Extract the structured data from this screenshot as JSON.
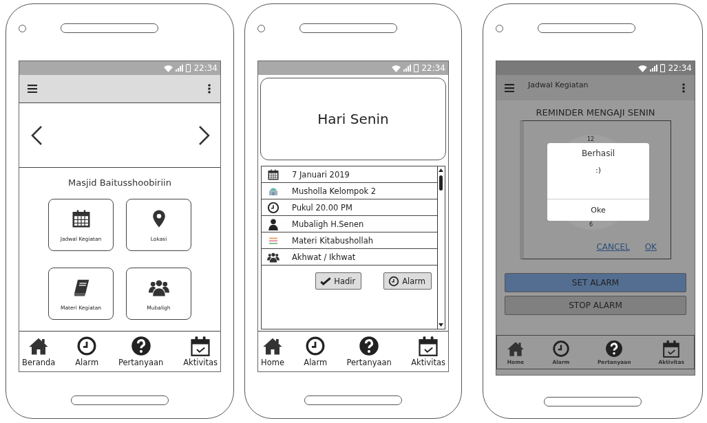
{
  "phones": [
    {
      "kind": "home",
      "status_time": "22:34",
      "title": "Masjid Baitusshoobiriin",
      "tiles": [
        {
          "label": "Jadwal Kegiatan"
        },
        {
          "label": "Lokasi"
        },
        {
          "label": "Materi Kegiatan"
        },
        {
          "label": "Mubaligh"
        }
      ],
      "bottom_nav": [
        {
          "label": "Beranda"
        },
        {
          "label": "Alarm"
        },
        {
          "label": "Pertanyaan"
        },
        {
          "label": "Aktivitas"
        }
      ]
    },
    {
      "kind": "detail",
      "status_time": "22:34",
      "heading": "Hari Senin",
      "details": [
        {
          "text": "7 Januari 2019"
        },
        {
          "text": "Musholla Kelompok 2"
        },
        {
          "text": "Pukul 20.00 PM"
        },
        {
          "text": "Mubaligh H.Senen"
        },
        {
          "text": "Materi Kitabushollah"
        },
        {
          "text": "Akhwat / Ikhwat"
        }
      ],
      "actions": [
        {
          "label": "Hadir"
        },
        {
          "label": "Alarm"
        }
      ],
      "bottom_nav": [
        {
          "label": "Home"
        },
        {
          "label": "Alarm"
        },
        {
          "label": "Pertanyaan"
        },
        {
          "label": "Aktivitas"
        }
      ]
    },
    {
      "kind": "alarm",
      "status_time": "22:34",
      "app_title": "Jadwal Kegiatan",
      "heading": "REMINDER MENGAJI SENIN",
      "clock_labels": [
        "12",
        "6"
      ],
      "picker_actions": [
        "CANCEL",
        "OK"
      ],
      "dialog": {
        "title": "Berhasil",
        "message": ":)",
        "button": "Oke"
      },
      "buttons": [
        {
          "label": "SET ALARM",
          "kind": "primary"
        },
        {
          "label": "STOP ALARM",
          "kind": "secondary"
        }
      ],
      "bottom_nav": [
        {
          "label": "Home"
        },
        {
          "label": "Alarm"
        },
        {
          "label": "Pertanyaan"
        },
        {
          "label": "Aktivitas"
        }
      ]
    }
  ]
}
